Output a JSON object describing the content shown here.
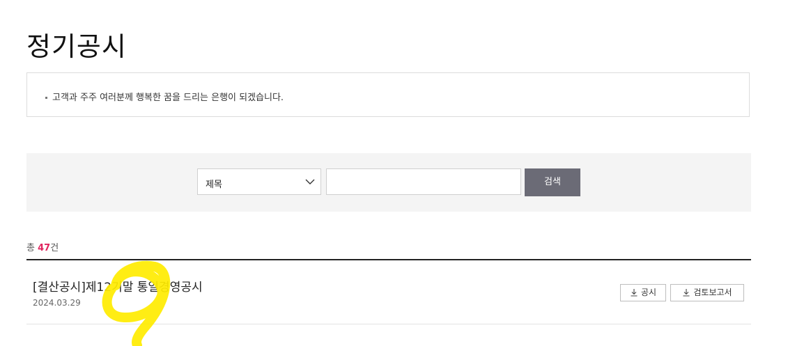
{
  "page": {
    "title": "정기공시"
  },
  "notice": {
    "text": "고객과 주주 여러분께 행복한 꿈을 드리는 은행이 되겠습니다."
  },
  "search": {
    "select_value": "제목",
    "input_value": "",
    "button_label": "검색"
  },
  "summary": {
    "prefix": "총 ",
    "count": "47",
    "suffix": "건"
  },
  "list": {
    "items": [
      {
        "title": "[결산공시]제12기말 통일경영공시",
        "date": "2024.03.29",
        "buttons": [
          "공시",
          "검토보고서"
        ]
      }
    ]
  },
  "colors": {
    "highlight": "#e0245e",
    "search_button": "#6b6b76",
    "annotation": "#ffeb00"
  },
  "icons": {
    "download": "download-icon",
    "chevron": "chevron-down-icon"
  }
}
